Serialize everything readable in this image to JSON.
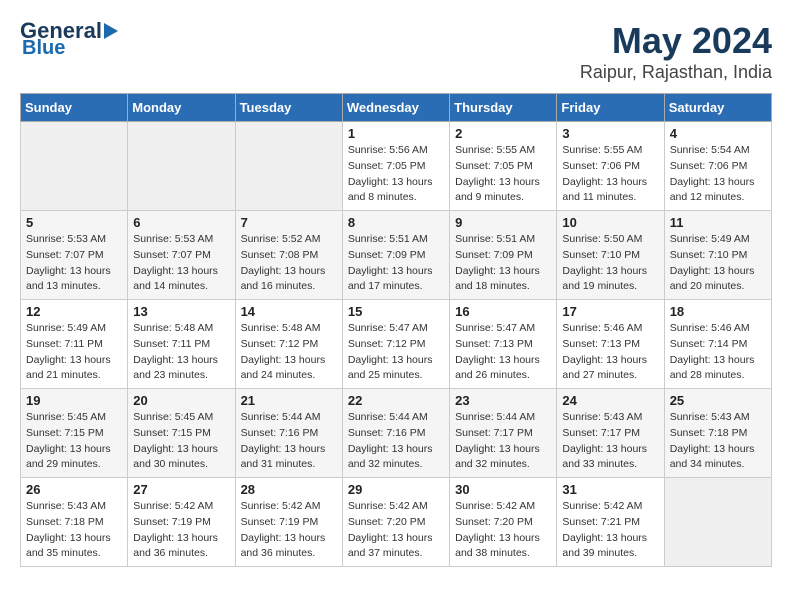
{
  "logo": {
    "line1": "General",
    "line2": "Blue"
  },
  "title": "May 2024",
  "subtitle": "Raipur, Rajasthan, India",
  "days_of_week": [
    "Sunday",
    "Monday",
    "Tuesday",
    "Wednesday",
    "Thursday",
    "Friday",
    "Saturday"
  ],
  "weeks": [
    [
      {
        "day": "",
        "info": ""
      },
      {
        "day": "",
        "info": ""
      },
      {
        "day": "",
        "info": ""
      },
      {
        "day": "1",
        "info": "Sunrise: 5:56 AM\nSunset: 7:05 PM\nDaylight: 13 hours\nand 8 minutes."
      },
      {
        "day": "2",
        "info": "Sunrise: 5:55 AM\nSunset: 7:05 PM\nDaylight: 13 hours\nand 9 minutes."
      },
      {
        "day": "3",
        "info": "Sunrise: 5:55 AM\nSunset: 7:06 PM\nDaylight: 13 hours\nand 11 minutes."
      },
      {
        "day": "4",
        "info": "Sunrise: 5:54 AM\nSunset: 7:06 PM\nDaylight: 13 hours\nand 12 minutes."
      }
    ],
    [
      {
        "day": "5",
        "info": "Sunrise: 5:53 AM\nSunset: 7:07 PM\nDaylight: 13 hours\nand 13 minutes."
      },
      {
        "day": "6",
        "info": "Sunrise: 5:53 AM\nSunset: 7:07 PM\nDaylight: 13 hours\nand 14 minutes."
      },
      {
        "day": "7",
        "info": "Sunrise: 5:52 AM\nSunset: 7:08 PM\nDaylight: 13 hours\nand 16 minutes."
      },
      {
        "day": "8",
        "info": "Sunrise: 5:51 AM\nSunset: 7:09 PM\nDaylight: 13 hours\nand 17 minutes."
      },
      {
        "day": "9",
        "info": "Sunrise: 5:51 AM\nSunset: 7:09 PM\nDaylight: 13 hours\nand 18 minutes."
      },
      {
        "day": "10",
        "info": "Sunrise: 5:50 AM\nSunset: 7:10 PM\nDaylight: 13 hours\nand 19 minutes."
      },
      {
        "day": "11",
        "info": "Sunrise: 5:49 AM\nSunset: 7:10 PM\nDaylight: 13 hours\nand 20 minutes."
      }
    ],
    [
      {
        "day": "12",
        "info": "Sunrise: 5:49 AM\nSunset: 7:11 PM\nDaylight: 13 hours\nand 21 minutes."
      },
      {
        "day": "13",
        "info": "Sunrise: 5:48 AM\nSunset: 7:11 PM\nDaylight: 13 hours\nand 23 minutes."
      },
      {
        "day": "14",
        "info": "Sunrise: 5:48 AM\nSunset: 7:12 PM\nDaylight: 13 hours\nand 24 minutes."
      },
      {
        "day": "15",
        "info": "Sunrise: 5:47 AM\nSunset: 7:12 PM\nDaylight: 13 hours\nand 25 minutes."
      },
      {
        "day": "16",
        "info": "Sunrise: 5:47 AM\nSunset: 7:13 PM\nDaylight: 13 hours\nand 26 minutes."
      },
      {
        "day": "17",
        "info": "Sunrise: 5:46 AM\nSunset: 7:13 PM\nDaylight: 13 hours\nand 27 minutes."
      },
      {
        "day": "18",
        "info": "Sunrise: 5:46 AM\nSunset: 7:14 PM\nDaylight: 13 hours\nand 28 minutes."
      }
    ],
    [
      {
        "day": "19",
        "info": "Sunrise: 5:45 AM\nSunset: 7:15 PM\nDaylight: 13 hours\nand 29 minutes."
      },
      {
        "day": "20",
        "info": "Sunrise: 5:45 AM\nSunset: 7:15 PM\nDaylight: 13 hours\nand 30 minutes."
      },
      {
        "day": "21",
        "info": "Sunrise: 5:44 AM\nSunset: 7:16 PM\nDaylight: 13 hours\nand 31 minutes."
      },
      {
        "day": "22",
        "info": "Sunrise: 5:44 AM\nSunset: 7:16 PM\nDaylight: 13 hours\nand 32 minutes."
      },
      {
        "day": "23",
        "info": "Sunrise: 5:44 AM\nSunset: 7:17 PM\nDaylight: 13 hours\nand 32 minutes."
      },
      {
        "day": "24",
        "info": "Sunrise: 5:43 AM\nSunset: 7:17 PM\nDaylight: 13 hours\nand 33 minutes."
      },
      {
        "day": "25",
        "info": "Sunrise: 5:43 AM\nSunset: 7:18 PM\nDaylight: 13 hours\nand 34 minutes."
      }
    ],
    [
      {
        "day": "26",
        "info": "Sunrise: 5:43 AM\nSunset: 7:18 PM\nDaylight: 13 hours\nand 35 minutes."
      },
      {
        "day": "27",
        "info": "Sunrise: 5:42 AM\nSunset: 7:19 PM\nDaylight: 13 hours\nand 36 minutes."
      },
      {
        "day": "28",
        "info": "Sunrise: 5:42 AM\nSunset: 7:19 PM\nDaylight: 13 hours\nand 36 minutes."
      },
      {
        "day": "29",
        "info": "Sunrise: 5:42 AM\nSunset: 7:20 PM\nDaylight: 13 hours\nand 37 minutes."
      },
      {
        "day": "30",
        "info": "Sunrise: 5:42 AM\nSunset: 7:20 PM\nDaylight: 13 hours\nand 38 minutes."
      },
      {
        "day": "31",
        "info": "Sunrise: 5:42 AM\nSunset: 7:21 PM\nDaylight: 13 hours\nand 39 minutes."
      },
      {
        "day": "",
        "info": ""
      }
    ]
  ]
}
